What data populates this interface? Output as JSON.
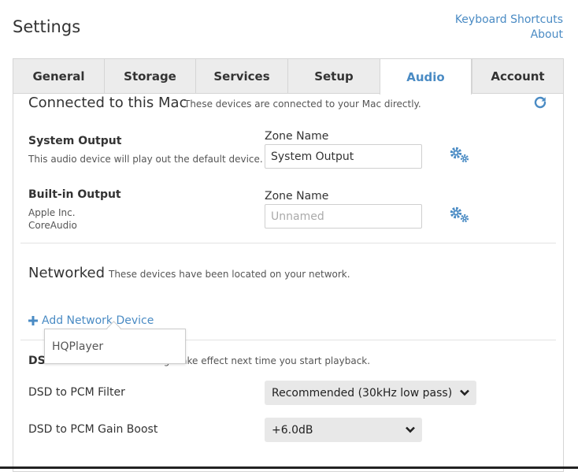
{
  "page": {
    "title": "Settings"
  },
  "top_links": {
    "keyboard_shortcuts": "Keyboard Shortcuts",
    "about": "About"
  },
  "tabs": [
    {
      "label": "General",
      "active": false
    },
    {
      "label": "Storage",
      "active": false
    },
    {
      "label": "Services",
      "active": false
    },
    {
      "label": "Setup",
      "active": false
    },
    {
      "label": "Audio",
      "active": true
    },
    {
      "label": "Account",
      "active": false
    }
  ],
  "connected": {
    "title": "Connected to this Mac",
    "subtitle": "These devices are connected to your Mac directly.",
    "refresh_icon": "refresh-icon",
    "devices": [
      {
        "name": "System Output",
        "desc": "This audio device will play out the default device.",
        "zone_label": "Zone Name",
        "zone_value": "System Output",
        "zone_placeholder": ""
      },
      {
        "name": "Built-in Output",
        "desc_line1": "Apple Inc.",
        "desc_line2": "CoreAudio",
        "zone_label": "Zone Name",
        "zone_value": "",
        "zone_placeholder": "Unnamed"
      }
    ]
  },
  "networked": {
    "title": "Networked",
    "subtitle": "These devices have been located on your network.",
    "add_label": "Add Network Device",
    "popup_items": [
      "HQPlayer"
    ]
  },
  "dsd": {
    "title": "DSD to PCM",
    "subtitle": "These settings take effect next time you start playback.",
    "filter_label": "DSD to PCM Filter",
    "filter_value": "Recommended (30kHz low pass)",
    "gain_label": "DSD to PCM Gain Boost",
    "gain_value": "+6.0dB"
  },
  "colors": {
    "accent": "#4a8bc4",
    "tab_bg": "#ececec",
    "select_bg": "#e8e8e8",
    "border": "#d5d5d5"
  }
}
